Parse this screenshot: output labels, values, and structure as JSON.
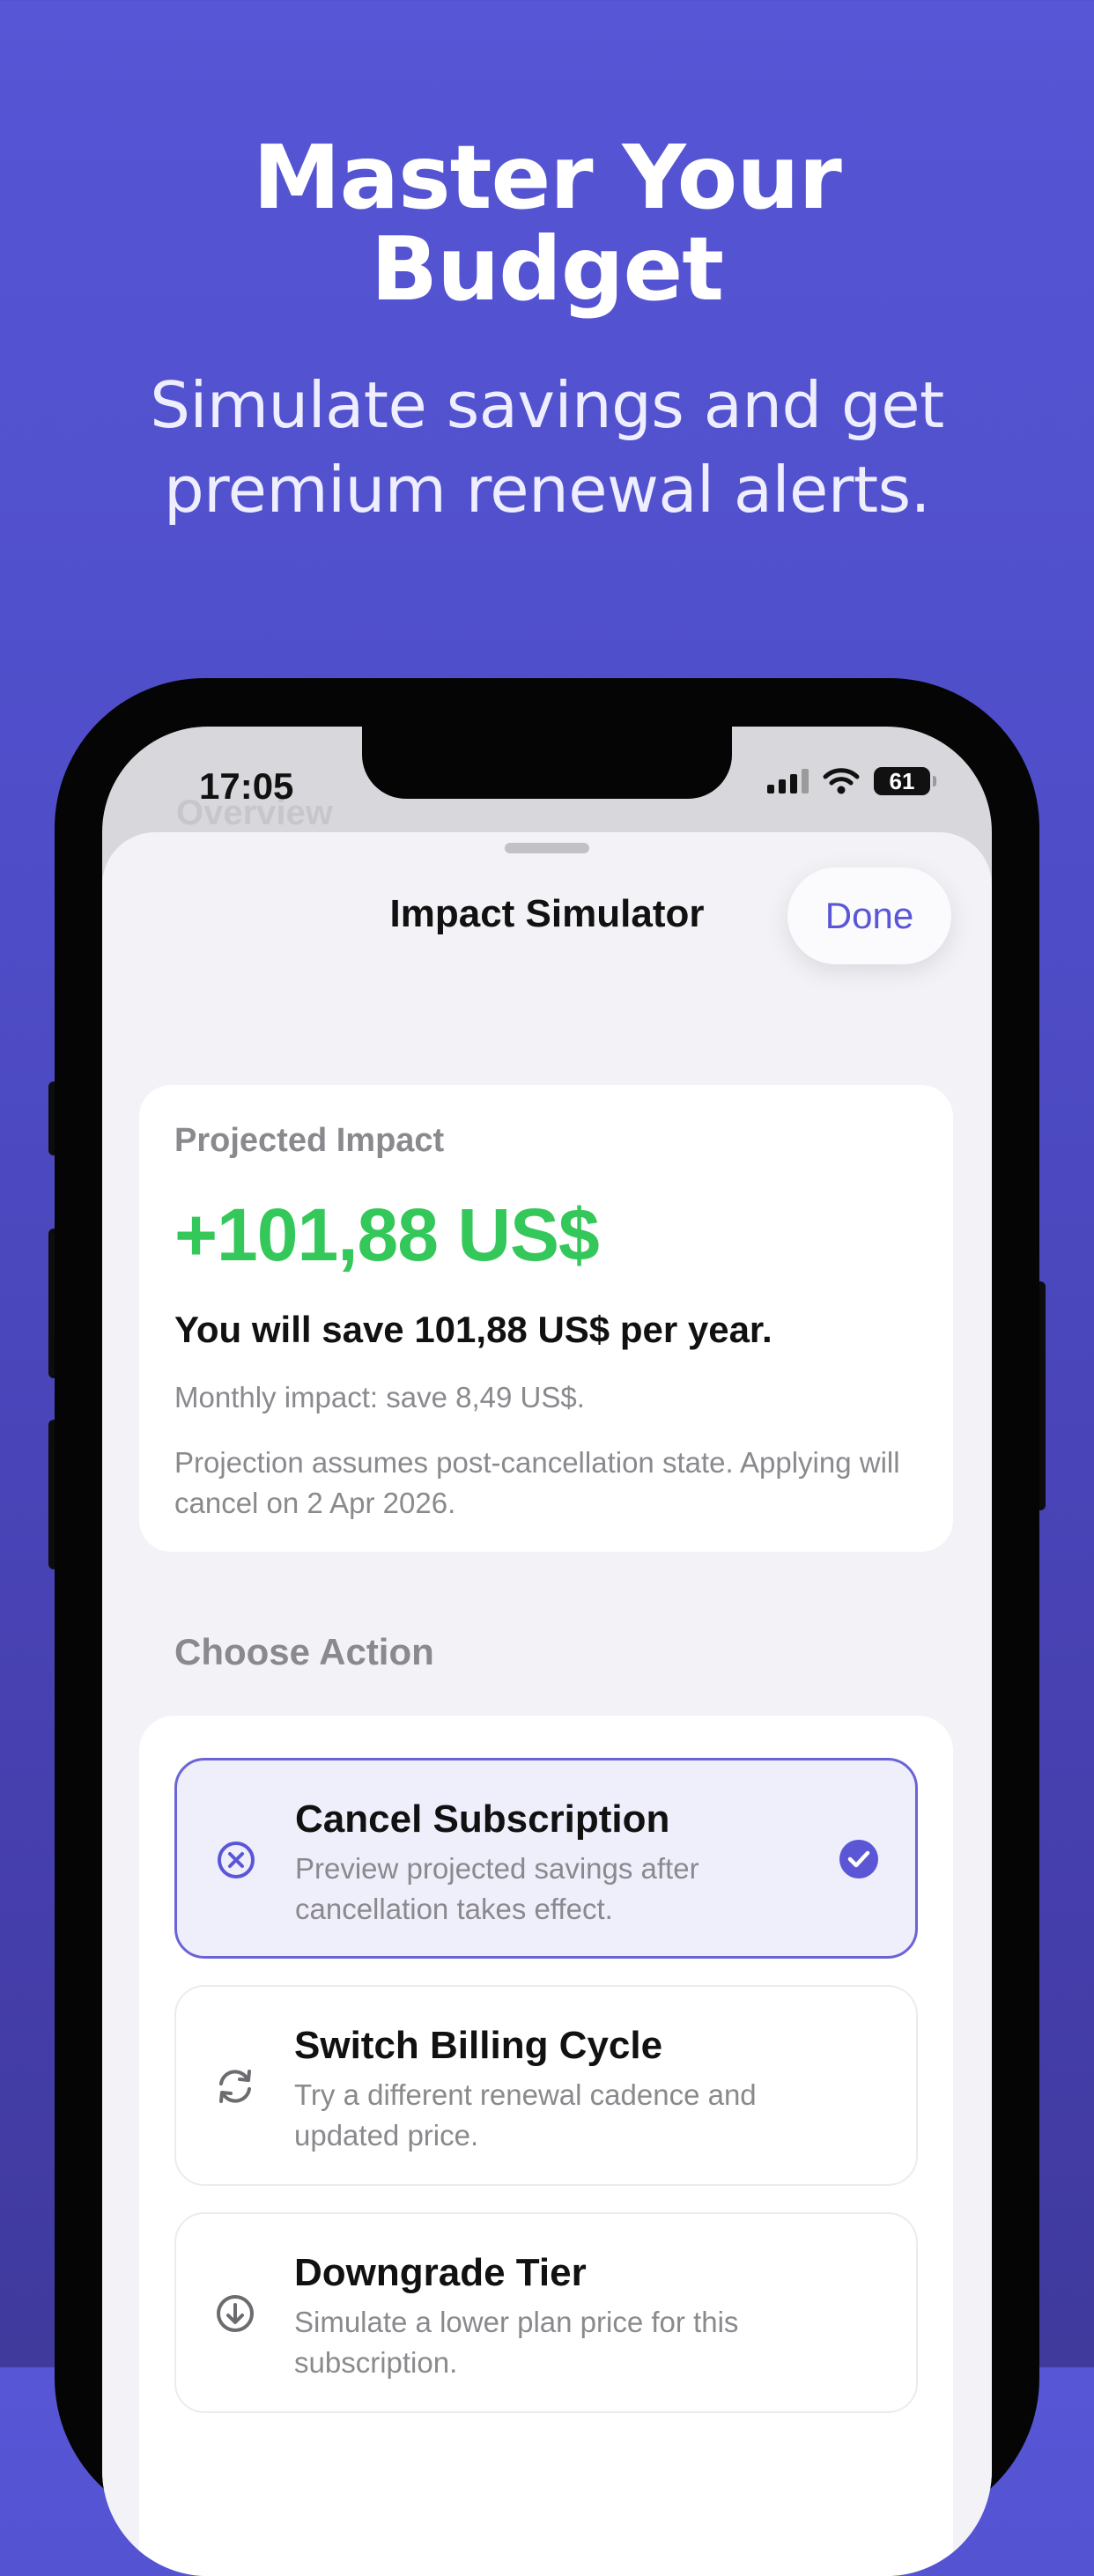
{
  "promo": {
    "headline_line1": "Master Your",
    "headline_line2": "Budget",
    "subhead_line1": "Simulate savings and get",
    "subhead_line2": "premium renewal alerts."
  },
  "status_bar": {
    "time": "17:05",
    "battery": "61"
  },
  "background_screen": {
    "title": "Overview"
  },
  "sheet": {
    "title": "Impact Simulator",
    "done_label": "Done"
  },
  "impact_card": {
    "label": "Projected Impact",
    "value": "+101,88 US$",
    "sentence": "You will save 101,88 US$ per year.",
    "monthly": "Monthly impact: save 8,49 US$.",
    "note": "Projection assumes post-cancellation state. Applying will cancel on 2 Apr 2026."
  },
  "actions": {
    "header": "Choose Action",
    "items": [
      {
        "title": "Cancel Subscription",
        "description": "Preview projected savings after cancellation takes effect.",
        "icon": "x-circle-icon",
        "selected": true
      },
      {
        "title": "Switch Billing Cycle",
        "description": "Try a different renewal cadence and updated price.",
        "icon": "refresh-cycle-icon",
        "selected": false
      },
      {
        "title": "Downgrade Tier",
        "description": "Simulate a lower plan price for this subscription.",
        "icon": "arrow-down-circle-icon",
        "selected": false
      }
    ]
  },
  "colors": {
    "accent": "#5b56d6",
    "positive": "#34c759",
    "background_top": "#5656d6",
    "background_bottom": "#3f3a9c"
  }
}
